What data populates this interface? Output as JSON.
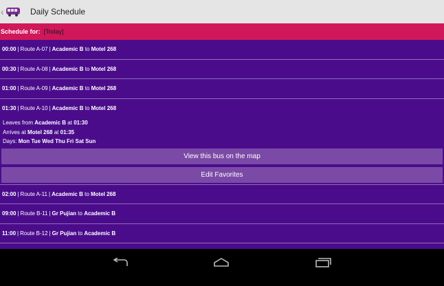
{
  "actionbar": {
    "title": "Daily Schedule",
    "icons": {
      "up": "up-caret-icon",
      "app": "bus-icon"
    }
  },
  "schedule": {
    "label": "Schedule for:",
    "value": "[Today]"
  },
  "rows": [
    {
      "time": "00:00",
      "route": "Route A-07",
      "from": "Academic B",
      "to_word": "to",
      "to": "Motel 268"
    },
    {
      "time": "00:30",
      "route": "Route A-08",
      "from": "Academic B",
      "to_word": "to",
      "to": "Motel 268"
    },
    {
      "time": "01:00",
      "route": "Route A-09",
      "from": "Academic B",
      "to_word": "to",
      "to": "Motel 268"
    },
    {
      "time": "01:30",
      "route": "Route A-10",
      "from": "Academic B",
      "to_word": "to",
      "to": "Motel 268"
    },
    {
      "time": "02:00",
      "route": "Route A-11",
      "from": "Academic B",
      "to_word": "to",
      "to": "Motel 268"
    },
    {
      "time": "09:00",
      "route": "Route B-11",
      "from": "Gr Pujian",
      "to_word": "to",
      "to": "Academic B"
    },
    {
      "time": "11:00",
      "route": "Route B-12",
      "from": "Gr Pujian",
      "to_word": "to",
      "to": "Academic B"
    }
  ],
  "expanded": {
    "leaves_label": "Leaves from",
    "leaves_place": "Academic B",
    "at_word": "at",
    "leaves_time": "01:30",
    "arrives_label": "Arrives at",
    "arrives_place": "Motel 268",
    "arrives_time": "01:35",
    "days_label": "Days:",
    "days": "Mon Tue Wed Thu Fri Sat Sun",
    "map_button": "View this bus on the map",
    "favorites_button": "Edit Favorites"
  },
  "navbar": {
    "icons": [
      "back-icon",
      "home-icon",
      "recent-apps-icon"
    ]
  },
  "colors": {
    "actionbar": "#e5e5e5",
    "schedule_bar": "#d0175a",
    "list_bg": "#4b0c8c",
    "button_bg": "#7a4aa6",
    "navbar": "#000000"
  }
}
